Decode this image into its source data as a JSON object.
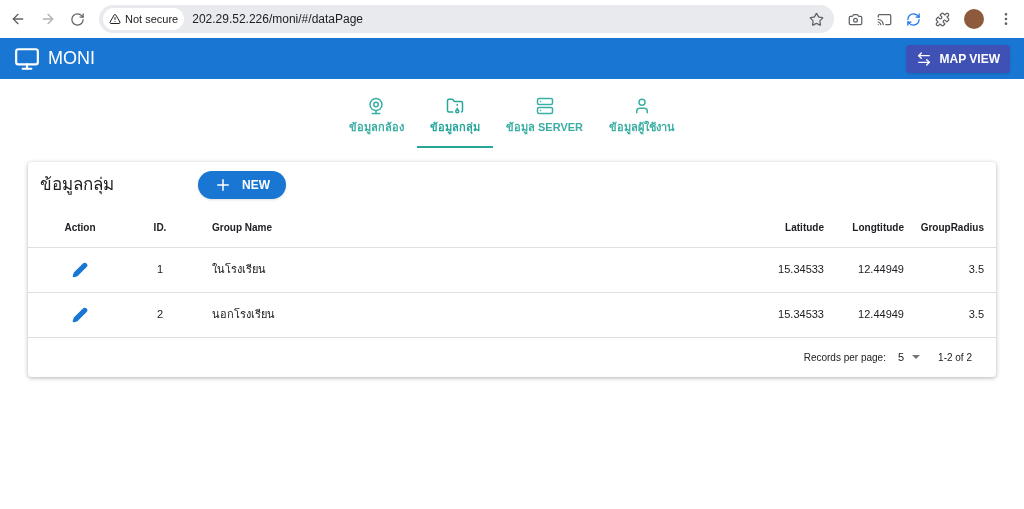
{
  "browser": {
    "security": "Not secure",
    "url": "202.29.52.226/moni/#/dataPage"
  },
  "app_bar": {
    "title": "MONI",
    "button": "MAP VIEW"
  },
  "tabs": [
    {
      "label": "ข้อมูลกล้อง",
      "kind": "camera",
      "selected": false
    },
    {
      "label": "ข้อมูลกลุ่ม",
      "kind": "folder",
      "selected": true
    },
    {
      "label": "ข้อมูล SERVER",
      "kind": "server",
      "selected": false
    },
    {
      "label": "ข้อมูลผู้ใช้งาน",
      "kind": "user",
      "selected": false
    }
  ],
  "card": {
    "title": "ข้อมูลกลุ่ม",
    "new_button": "NEW"
  },
  "table": {
    "columns": [
      "Action",
      "ID.",
      "Group Name",
      "Latitude",
      "Longtitude",
      "GroupRadius"
    ],
    "rows": [
      {
        "id": "1",
        "group_name": "ในโรงเรียน",
        "latitude": "15.34533",
        "longtitude": "12.44949",
        "group_radius": "3.5"
      },
      {
        "id": "2",
        "group_name": "นอกโรงเรียน",
        "latitude": "15.34533",
        "longtitude": "12.44949",
        "group_radius": "3.5"
      }
    ]
  },
  "pagination": {
    "label": "Records per page:",
    "per_page": "5",
    "range": "1-2 of 2"
  }
}
